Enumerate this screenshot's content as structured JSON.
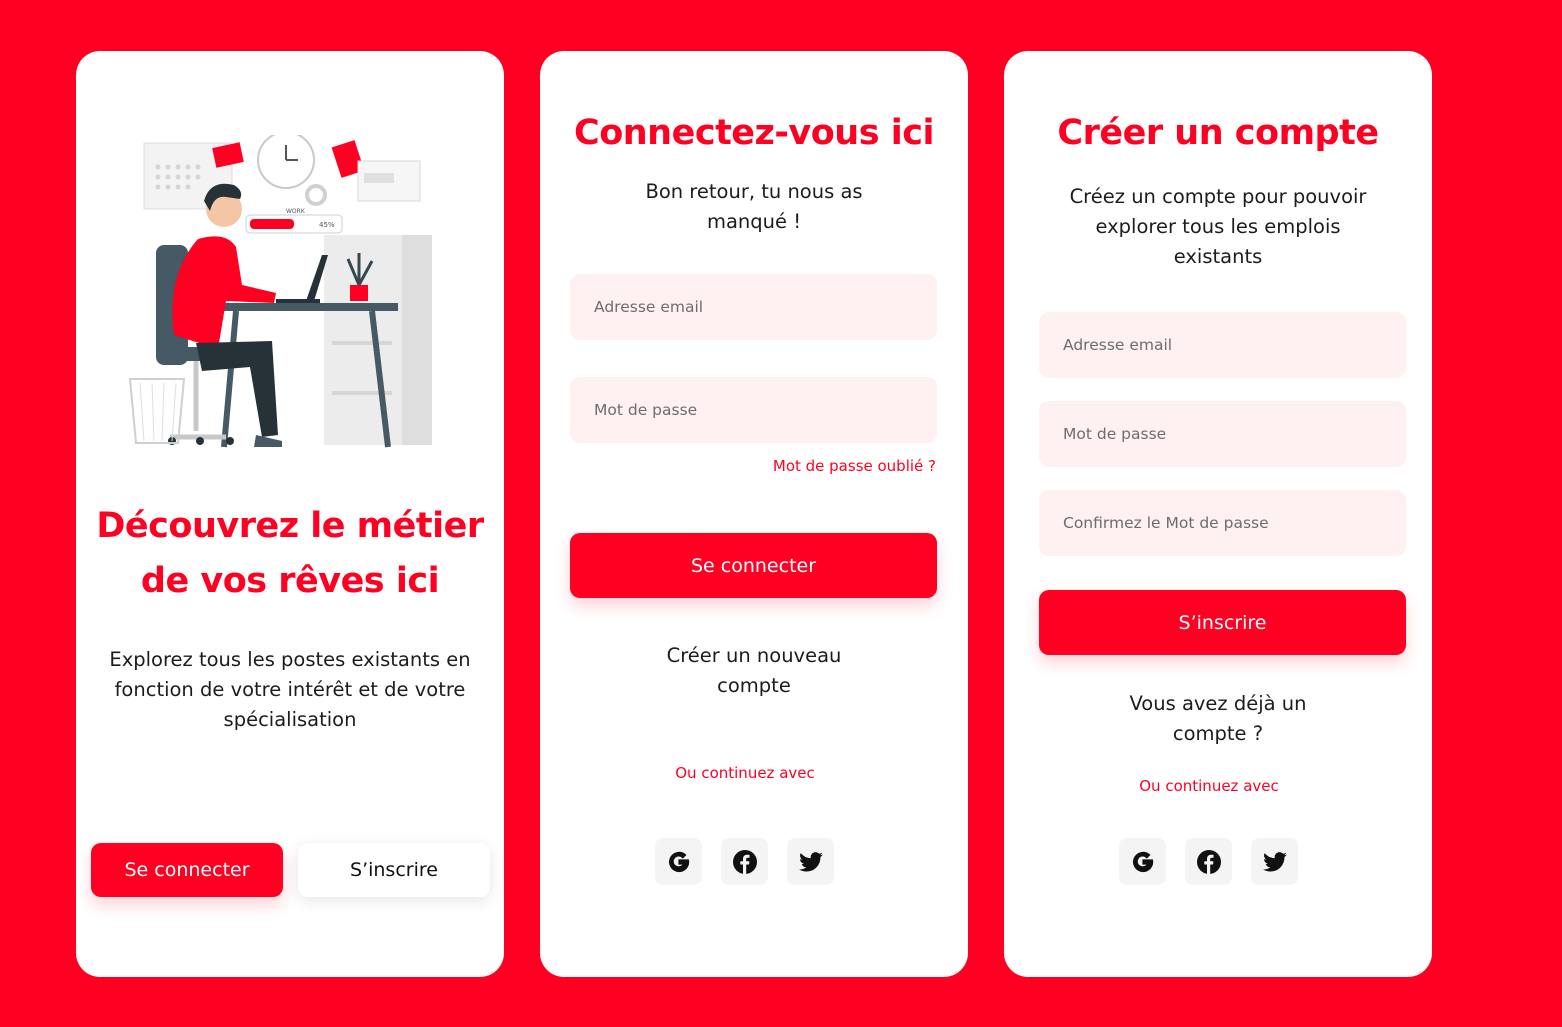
{
  "onboarding": {
    "title_line1": "Découvrez le métier",
    "title_line2": "de vos rêves ici",
    "description_line1": "Explorez tous les postes existants en",
    "description_line2": "fonction de votre intérêt et de votre",
    "description_line3": "spécialisation",
    "login_label": "Se connecter",
    "signup_label": "S’inscrire",
    "illustration": {
      "badge_label": "WORK",
      "progress": "45%"
    }
  },
  "login": {
    "title": "Connectez-vous ici",
    "subtitle_line1": "Bon retour, tu nous as",
    "subtitle_line2": "manqué !",
    "email_placeholder": "Adresse email",
    "password_placeholder": "Mot de passe",
    "forgot_label": "Mot de passe oublié ?",
    "submit_label": "Se connecter",
    "create_line1": "Créer un nouveau",
    "create_line2": "compte",
    "continue_label": "Ou continuez avec",
    "socials": [
      "google-icon",
      "facebook-icon",
      "twitter-icon"
    ]
  },
  "register": {
    "title": "Créer un compte",
    "subtitle_line1": "Créez un compte pour pouvoir",
    "subtitle_line2": "explorer tous les emplois",
    "subtitle_line3": "existants",
    "email_placeholder": "Adresse email",
    "password_placeholder": "Mot de passe",
    "confirm_placeholder": "Confirmez le Mot de passe",
    "submit_label": "S’inscrire",
    "existing_line1": "Vous avez déjà un",
    "existing_line2": "compte ?",
    "continue_label": "Ou continuez avec",
    "socials": [
      "google-icon",
      "facebook-icon",
      "twitter-icon"
    ]
  },
  "colors": {
    "brand": "#ff0022",
    "field_bg": "#fff1f2",
    "text": "#1c1c1c"
  }
}
